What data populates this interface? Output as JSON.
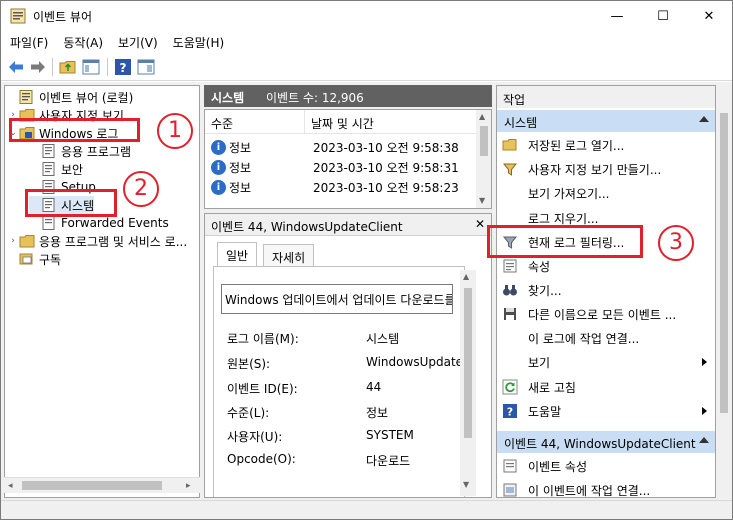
{
  "window": {
    "title": "이벤트 뷰어",
    "minimize_glyph": "—",
    "maximize_glyph": "☐",
    "close_glyph": "✕"
  },
  "menu": [
    "파일(F)",
    "동작(A)",
    "보기(V)",
    "도움말(H)"
  ],
  "tree": {
    "root": "이벤트 뷰어 (로컬)",
    "custom_views": "사용자 지정 보기",
    "windows_logs": "Windows 로그",
    "app_log": "응용 프로그램",
    "security": "보안",
    "setup": "Setup",
    "system": "시스템",
    "forwarded": "Forwarded Events",
    "app_services": "응용 프로그램 및 서비스 로...",
    "subscriptions": "구독"
  },
  "event_list": {
    "log_name": "시스템",
    "count_label": "이벤트 수: 12,906",
    "col_level": "수준",
    "col_datetime": "날짜 및 시간",
    "rows": [
      {
        "level": "정보",
        "datetime": "2023-03-10 오전 9:58:38"
      },
      {
        "level": "정보",
        "datetime": "2023-03-10 오전 9:58:31"
      },
      {
        "level": "정보",
        "datetime": "2023-03-10 오전 9:58:23"
      }
    ]
  },
  "detail": {
    "title": "이벤트 44, WindowsUpdateClient",
    "tab_general": "일반",
    "tab_details": "자세히",
    "message": "Windows 업데이트에서 업데이트 다운로드를",
    "props": [
      {
        "label": "로그 이름(M):",
        "value": "시스템"
      },
      {
        "label": "원본(S):",
        "value": "WindowsUpdateClient"
      },
      {
        "label": "이벤트 ID(E):",
        "value": "44"
      },
      {
        "label": "수준(L):",
        "value": "정보"
      },
      {
        "label": "사용자(U):",
        "value": "SYSTEM"
      },
      {
        "label": "Opcode(O):",
        "value": "다운로드"
      }
    ]
  },
  "actions": {
    "title": "작업",
    "section_system": "시스템",
    "items": [
      "저장된 로그 열기...",
      "사용자 지정 보기 만들기...",
      "보기 가져오기...",
      "로그 지우기...",
      "현재 로그 필터링...",
      "속성",
      "찾기...",
      "다른 이름으로 모든 이벤트 ...",
      "이 로그에 작업 연결...",
      "보기",
      "새로 고침",
      "도움말"
    ],
    "section_event": "이벤트 44, WindowsUpdateClient",
    "event_items": [
      "이벤트 속성",
      "이 이벤트에 작업 연결..."
    ]
  },
  "annotations": [
    "1",
    "2",
    "3"
  ],
  "colors": {
    "annotation_red": "#e0202a",
    "section_header_blue": "#c9def5",
    "list_header_gray": "#616161"
  }
}
